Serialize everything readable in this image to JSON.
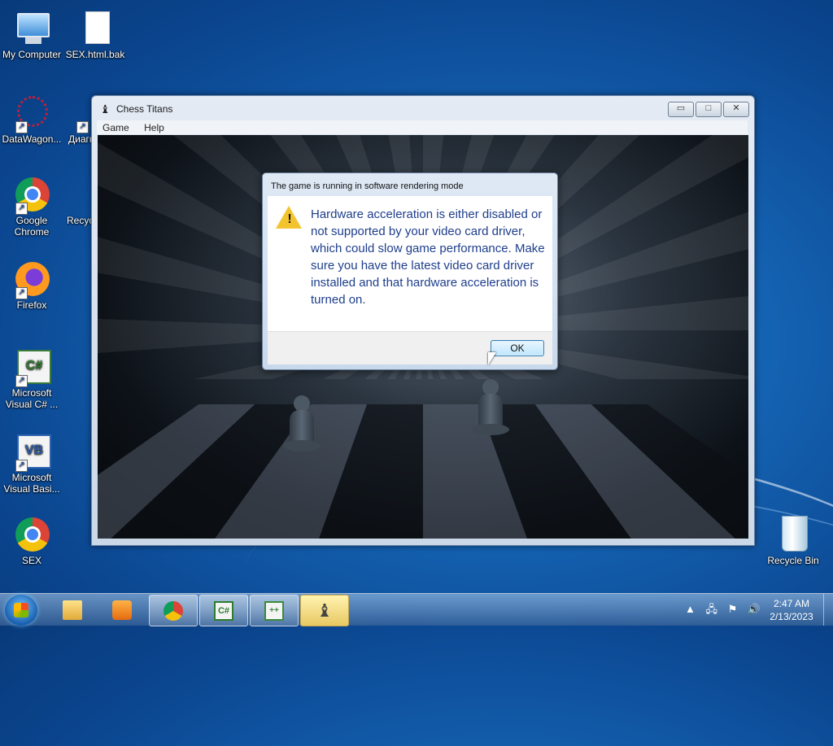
{
  "desktop": {
    "icons": [
      {
        "label": "My Computer"
      },
      {
        "label": "SEX.html.bak"
      },
      {
        "label": "DataWagon..."
      },
      {
        "label": "Диагн позн"
      },
      {
        "label": "Google Chrome"
      },
      {
        "label": "Recyc Shc"
      },
      {
        "label": "Firefox"
      },
      {
        "label": "Microsoft Visual C# ..."
      },
      {
        "label": "Microsoft Visual Basi..."
      },
      {
        "label": "SEX"
      },
      {
        "label": "Recycle Bin"
      }
    ]
  },
  "window": {
    "title": "Chess Titans",
    "app_icon": "chess-pawn-icon",
    "controls": {
      "minimize": "▭",
      "maximize": "□",
      "close": "✕"
    },
    "menu": [
      {
        "label": "Game"
      },
      {
        "label": "Help"
      }
    ]
  },
  "dialog": {
    "title": "The game is running in software rendering mode",
    "icon": "warning-icon",
    "message": "Hardware acceleration is either disabled or not supported by your video card driver, which could slow game performance. Make sure you have the latest video card driver installed and that hardware acceleration is turned on.",
    "ok_label": "OK"
  },
  "taskbar": {
    "items": [
      {
        "icon": "windows-explorer-icon"
      },
      {
        "icon": "media-player-icon"
      },
      {
        "icon": "chrome-icon"
      },
      {
        "icon": "visual-csharp-icon",
        "glyph": "C#"
      },
      {
        "icon": "visual-cpp-icon",
        "glyph": "++"
      },
      {
        "icon": "chess-titans-icon",
        "glyph": "♝"
      }
    ],
    "tray": {
      "up_arrow": "▲",
      "network": "🖧",
      "flag": "⚑",
      "volume": "🔊"
    },
    "time": "2:47 AM",
    "date": "2/13/2023"
  }
}
